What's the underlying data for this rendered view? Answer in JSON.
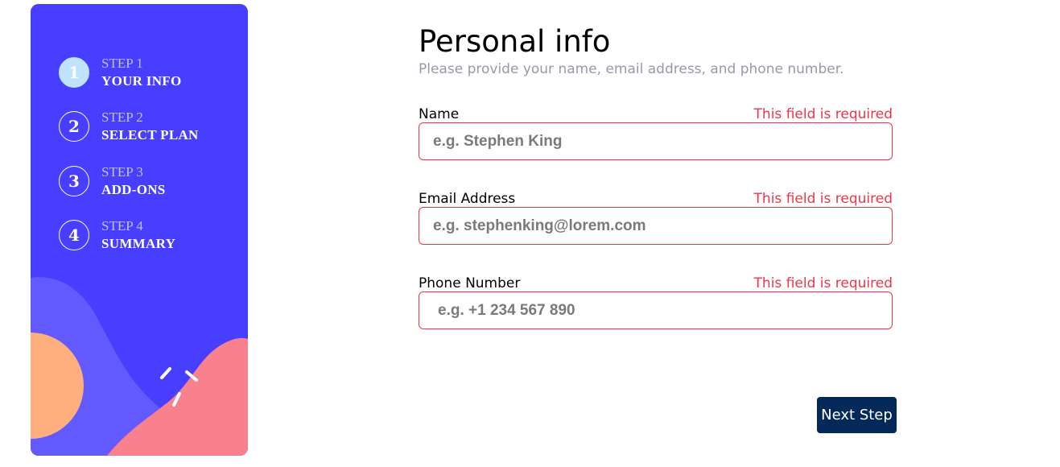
{
  "sidebar": {
    "steps": [
      {
        "number": "1",
        "caption": "STEP 1",
        "title": "YOUR INFO",
        "active": true
      },
      {
        "number": "2",
        "caption": "STEP 2",
        "title": "SELECT PLAN",
        "active": false
      },
      {
        "number": "3",
        "caption": "STEP 3",
        "title": "ADD-ONS",
        "active": false
      },
      {
        "number": "4",
        "caption": "STEP 4",
        "title": "SUMMARY",
        "active": false
      }
    ]
  },
  "form": {
    "title": "Personal info",
    "subtitle": "Please provide your name, email address, and phone number.",
    "fields": [
      {
        "label": "Name",
        "error": "This field is required",
        "placeholder": "e.g. Stephen King",
        "value": ""
      },
      {
        "label": "Email Address",
        "error": "This field is required",
        "placeholder": "e.g. stephenking@lorem.com",
        "value": ""
      },
      {
        "label": "Phone Number",
        "error": "This field is required",
        "placeholder": "e.g. +1 234 567 890",
        "value": ""
      }
    ],
    "next_label": "Next Step"
  },
  "colors": {
    "sidebar_bg": "#483eff",
    "active_step": "#bfe2fd",
    "error": "#ed3548",
    "button_bg": "#02295a",
    "subtitle": "#9699ab"
  }
}
